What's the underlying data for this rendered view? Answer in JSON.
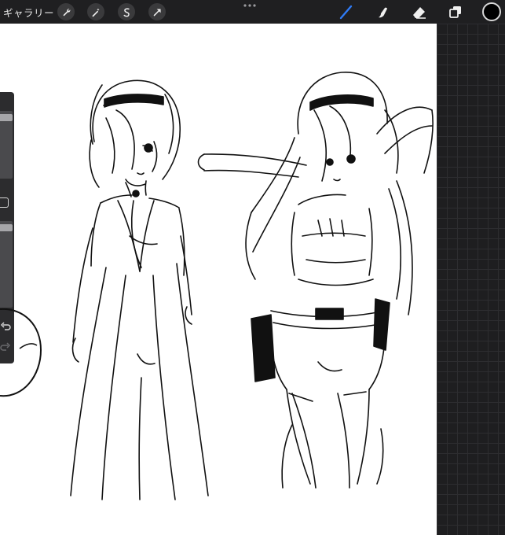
{
  "app": {
    "gallery_label": "ギャラリー",
    "selected_color": "#000000",
    "accent_color": "#2f7bf6"
  },
  "toolbar": {
    "left_tools": [
      "wrench-icon",
      "magic-wand-icon",
      "selection-icon",
      "transform-icon"
    ],
    "more_icon": "more-dots-icon",
    "right_tools": [
      "brush-icon",
      "smudge-icon",
      "eraser-icon",
      "layers-icon",
      "color-icon"
    ],
    "active_tool": "brush-icon"
  },
  "sidebar": {
    "brush_size_slider": 0.95,
    "opacity_slider": 0.96,
    "controls": [
      "modify-button-icon",
      "undo-icon",
      "redo-icon"
    ]
  }
}
